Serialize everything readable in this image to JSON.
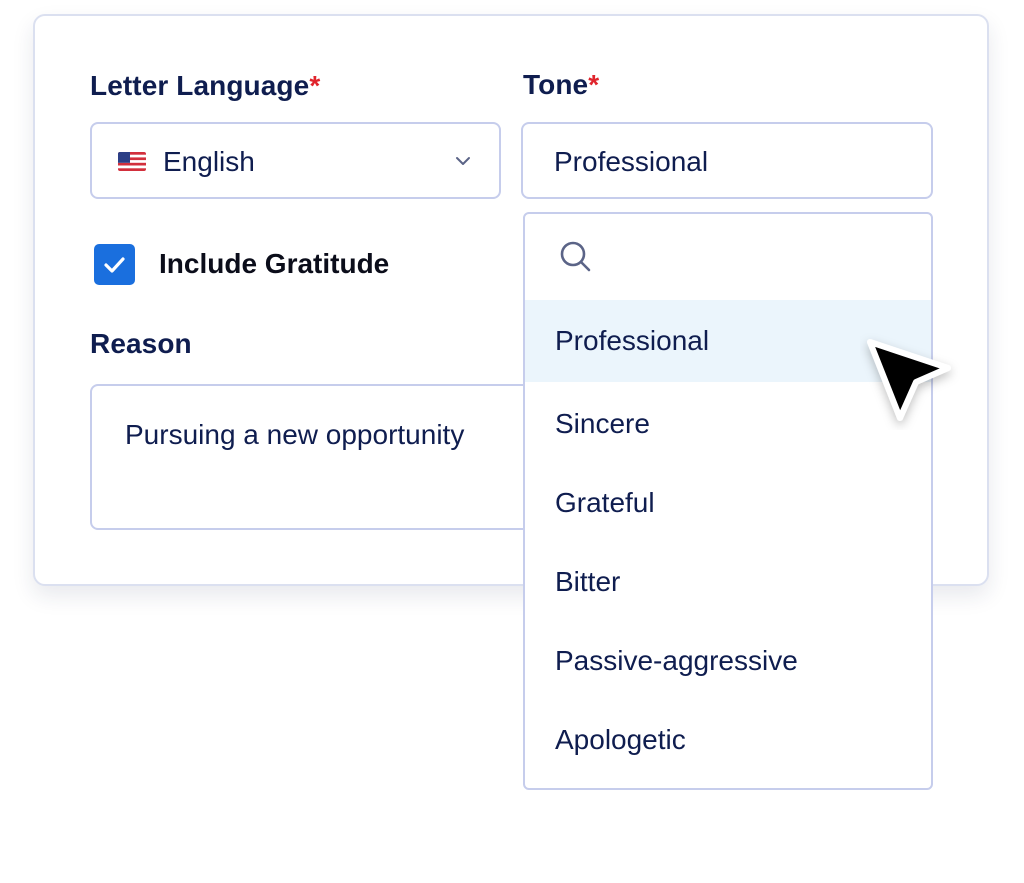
{
  "form": {
    "language_label": "Letter Language",
    "tone_label": "Tone",
    "required_mark": "*",
    "language_value": "English",
    "language_flag": "us-flag-icon",
    "tone_value": "Professional",
    "gratitude_label": "Include Gratitude",
    "gratitude_checked": true,
    "reason_label": "Reason",
    "reason_value": "Pursuing a new opportunity"
  },
  "tone_dropdown": {
    "search_icon": "search-icon",
    "options": [
      {
        "label": "Professional",
        "highlighted": true
      },
      {
        "label": "Sincere",
        "highlighted": false
      },
      {
        "label": "Grateful",
        "highlighted": false
      },
      {
        "label": "Bitter",
        "highlighted": false
      },
      {
        "label": "Passive-aggressive",
        "highlighted": false
      },
      {
        "label": "Apologetic",
        "highlighted": false
      }
    ]
  },
  "colors": {
    "text": "#0f1d4f",
    "required": "#e0242c",
    "checkbox": "#1a6fde",
    "highlight": "#ebf5fc",
    "border": "#c6cdec"
  }
}
